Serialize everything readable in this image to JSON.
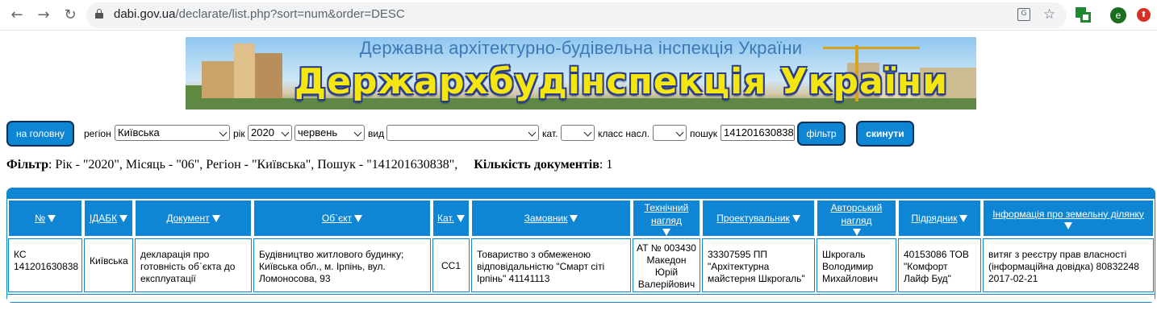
{
  "browser": {
    "url_host": "dabi.gov.ua",
    "url_path": "/declarate/list.php?sort=num&order=DESC",
    "ext_e_label": "e"
  },
  "banner": {
    "subtitle": "Державна архітектурно-будівельна інспекція України",
    "title": "Держархбудінспекція України"
  },
  "toolbar": {
    "home_button": "на головну",
    "region_label": "регіон",
    "region_value": "Київська",
    "year_label": "рік",
    "year_value": "2020",
    "month_value": "червень",
    "type_label": "вид",
    "type_value": "",
    "cat_label": "кат.",
    "cat_value": "",
    "class_label": "класс насл.",
    "class_value": "",
    "search_label": "пошук",
    "search_value": "141201630838",
    "filter_button": "фільтр",
    "reset_button": "скинути"
  },
  "filter_summary": {
    "label": "Фільтр",
    "text": ": Рік - \"2020\", Місяць - \"06\", Регіон - \"Київська\", Пошук - \"141201630838\",",
    "count_label": "Кількість документів",
    "count_value": ": 1"
  },
  "table": {
    "headers": [
      "№",
      "ІДАБК",
      "Документ",
      "Об`єкт",
      "Кат.",
      "Замовник",
      "Технічний нагляд",
      "Проектувальник",
      "Авторський нагляд",
      "Підрядник",
      "Інформація про земельну ділянку"
    ],
    "rows": [
      {
        "num": "КС 141201630838",
        "idabk": "Київська",
        "document": "декларація про готовність об`єкта до експлуатації",
        "object": "Будівництво житлового будинку; Київська обл., м. Ірпінь, вул. Ломоносова, 93",
        "cat": "СС1",
        "customer": "Товариство з обмеженою відповідальністю \"Смарт сіті Ірпінь\" 41141113",
        "tech_supervision": "АТ № 003430 Македон Юрій Валерійович",
        "designer": "33307595 ПП \"Архітектурна майстерня Шкрогаль\"",
        "author_supervision": "Шкрогаль Володимир Михайлович",
        "contractor": "40153086 ТОВ \"Комфорт Лайф Буд\"",
        "land_info": "витяг з реєстру прав власності (інформаційна довідка) 80832248 2017-02-21"
      }
    ]
  }
}
